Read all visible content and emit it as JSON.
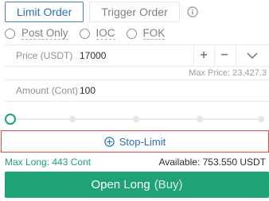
{
  "tabs": {
    "limit_order": "Limit Order",
    "trigger_order": "Trigger Order",
    "info_icon": "info-circle-icon"
  },
  "options": [
    {
      "label": "Post Only"
    },
    {
      "label": "IOC"
    },
    {
      "label": "FOK"
    }
  ],
  "price": {
    "label": "Price (USDT)",
    "value": "17000",
    "increment_icon": "plus-icon",
    "decrement_icon": "minus-icon",
    "dropdown_icon": "chevron-down-icon",
    "plus": "+",
    "minus": "−",
    "max_price": "Max Price: 23,427.3"
  },
  "amount": {
    "label": "Amount (Cont)",
    "value": "100"
  },
  "slider": {
    "value_percent": 0
  },
  "stop_limit": {
    "label": "Stop-Limit",
    "icon": "plus-circle-icon"
  },
  "footer": {
    "max_long": "Max Long: 443 Cont",
    "available": "Available: 753.550 USDT"
  },
  "open_long": {
    "label": "Open Long",
    "sub_label": "(Buy)"
  },
  "colors": {
    "accent": "#2d6fb8",
    "long_green": "#1fa276",
    "highlight_red": "#e04a4a"
  }
}
